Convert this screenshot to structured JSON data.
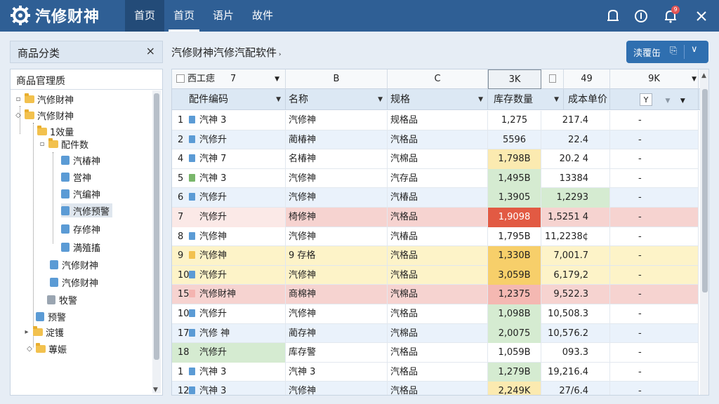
{
  "app": {
    "name": "汽修财神"
  },
  "nav": {
    "tabs": [
      {
        "label": "首页",
        "active": true
      },
      {
        "label": "首页",
        "active": false,
        "underlined": true
      },
      {
        "label": "语片",
        "active": false
      },
      {
        "label": "故件",
        "active": false
      }
    ],
    "notification_count": "9"
  },
  "left_panel": {
    "title": "商品分类",
    "close": "×",
    "tree_title": "商品官理质",
    "nodes": [
      {
        "label": "汽修財神",
        "icon": "folder-icon",
        "expander": "▫"
      },
      {
        "label": "汽修财神",
        "icon": "folder-icon",
        "expander": "◇"
      },
      {
        "label": "1效量",
        "icon": "folder-icon",
        "expander": ""
      },
      {
        "label": "配件数",
        "icon": "folder-icon",
        "expander": "▫"
      },
      {
        "label": "汽椿神",
        "icon": "file-icon"
      },
      {
        "label": "営神",
        "icon": "file-icon"
      },
      {
        "label": "汽编神",
        "icon": "file-icon"
      },
      {
        "label": "汽修预警",
        "icon": "file-icon",
        "selected": true
      },
      {
        "label": "存修神",
        "icon": "file-icon"
      },
      {
        "label": "満殖搐",
        "icon": "file-icon"
      },
      {
        "label": "汽修财神",
        "icon": "file-icon"
      },
      {
        "label": "汽修财神",
        "icon": "file-icon"
      },
      {
        "label": "牧警",
        "icon": "file-gray-icon"
      },
      {
        "label": "预警",
        "icon": "file-icon"
      },
      {
        "label": "淀镬",
        "icon": "folder-icon"
      },
      {
        "label": "蓴娠",
        "icon": "folder-icon"
      }
    ]
  },
  "main": {
    "title": "汽修财神汽修汽配软件",
    "action_button": {
      "label": "渎覆缶",
      "icon": "⎘",
      "dropdown": "∨"
    },
    "column_letters": [
      "西工痣",
      "7",
      "B",
      "C",
      "3K",
      "49",
      "9K"
    ],
    "headers": [
      "配件编码",
      "名称",
      "规格",
      "库存数量",
      "成本单价",
      "Y"
    ],
    "rows": [
      {
        "n": "1",
        "code": "汽神 3",
        "name": "汽修神",
        "spec": "规格品",
        "qty": "1,275",
        "cost": "217.4",
        "flag": "-",
        "mark": "#5b9bd5",
        "qtybg": "",
        "rowbg": "#ffffff"
      },
      {
        "n": "2",
        "code": "汽修升",
        "name": "蔺椿神",
        "spec": "汽格品",
        "qty": "5596",
        "cost": "22.4",
        "flag": "-",
        "mark": "#5b9bd5",
        "qtybg": "",
        "rowbg": "#eaf2fb"
      },
      {
        "n": "4",
        "code": "汽神 7",
        "name": "名椿神",
        "spec": "汽棉品",
        "qty": "1,798B",
        "cost": "20.2 4",
        "flag": "-",
        "mark": "#5b9bd5",
        "qtybg": "#fbeab0",
        "rowbg": "#ffffff"
      },
      {
        "n": "5",
        "code": "汽神 3",
        "name": "汽修神",
        "spec": "汽存品",
        "qty": "1,495B",
        "cost": "13384",
        "flag": "-",
        "mark": "#79b66a",
        "qtybg": "#d5ebd1",
        "rowbg": "#ffffff"
      },
      {
        "n": "6",
        "code": "汽修升",
        "name": "汽修神",
        "spec": "汽椿品",
        "qty": "1,3905",
        "cost": "1,2293",
        "flag": "-",
        "mark": "#5b9bd5",
        "qtybg": "#d5ebd1",
        "rowbg": "#eaf2fb",
        "costbg": "#d5ebd1"
      },
      {
        "n": "7",
        "code": "汽修升",
        "name": "椅修神",
        "spec": "汽格品",
        "qty": "1,9098",
        "cost": "1,5251 4",
        "flag": "-",
        "mark": "",
        "qtybg": "#e25a43",
        "rowbg": "#f6d3d0",
        "qtycolor": "#ffffff",
        "firstbg": "#fbe9e7"
      },
      {
        "n": "8",
        "code": "汽修神",
        "name": "汽修神",
        "spec": "汽椿品",
        "qty": "1,795B",
        "cost": "11,2238¢",
        "flag": "-",
        "mark": "#5b9bd5",
        "qtybg": "",
        "rowbg": "#ffffff"
      },
      {
        "n": "9",
        "code": "汽修神",
        "name": "9 存格",
        "spec": "汽格品",
        "qty": "1,330B",
        "cost": "7,001.7",
        "flag": "-",
        "mark": "#f2c14e",
        "qtybg": "#f7cf6a",
        "rowbg": "#fdf3c8"
      },
      {
        "n": "10",
        "code": "汽修升",
        "name": "汽修神",
        "spec": "汽格品",
        "qty": "3,059B",
        "cost": "6,179,2",
        "flag": "-",
        "mark": "#5b9bd5",
        "qtybg": "#f7cf6a",
        "rowbg": "#fdf3c8"
      },
      {
        "n": "15",
        "code": "汽修財神",
        "name": "商棉神",
        "spec": "汽棉品",
        "qty": "1,2375",
        "cost": "9,522.3",
        "flag": "-",
        "mark": "#f4b4b0",
        "qtybg": "#f4b8b2",
        "rowbg": "#f6d3d0"
      },
      {
        "n": "10",
        "code": "汽修升",
        "name": "汽修神",
        "spec": "汽格品",
        "qty": "1,098B",
        "cost": "10,508.3",
        "flag": "-",
        "mark": "#5b9bd5",
        "qtybg": "#d5ebd1",
        "rowbg": "#ffffff"
      },
      {
        "n": "17",
        "code": "汽修 神",
        "name": "蔺存神",
        "spec": "汽棉品",
        "qty": "2,0075",
        "cost": "10,576.2",
        "flag": "-",
        "mark": "#5b9bd5",
        "qtybg": "#d5ebd1",
        "rowbg": "#eaf2fb"
      },
      {
        "n": "18",
        "code": "汽修升",
        "name": "库存警",
        "spec": "汽格品",
        "qty": "1,059B",
        "cost": "093.3",
        "flag": "-",
        "mark": "",
        "qtybg": "",
        "rowbg": "#ffffff",
        "firstbg": "#d5ebd1"
      },
      {
        "n": "1",
        "code": "汽神 3",
        "name": "汽神 3",
        "spec": "汽格品",
        "qty": "1,279B",
        "cost": "19,216.4",
        "flag": "-",
        "mark": "#5b9bd5",
        "qtybg": "#d5ebd1",
        "rowbg": "#ffffff"
      },
      {
        "n": "12",
        "code": "汽神 3",
        "name": "汽修神",
        "spec": "汽格品",
        "qty": "2,249K",
        "cost": "27/6.4",
        "flag": "-",
        "mark": "#5b9bd5",
        "qtybg": "#fbeab0",
        "rowbg": "#eaf2fb"
      }
    ]
  },
  "colors": {
    "topbar": "#2f5f95",
    "accent": "#2f6fb0",
    "warning_red": "#e25a43",
    "warning_yellow": "#f7cf6a",
    "ok_green": "#d5ebd1"
  }
}
